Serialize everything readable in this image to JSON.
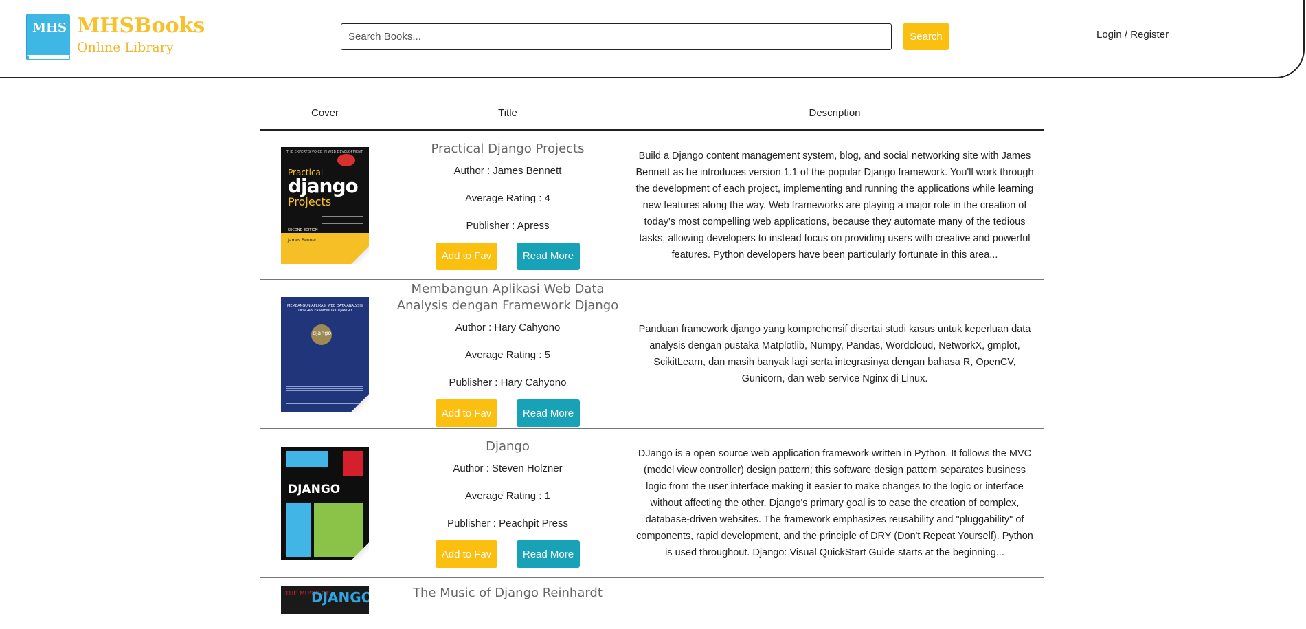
{
  "header": {
    "logo_badge": "MHS",
    "logo_name": "MHSBooks",
    "logo_subtitle": "Online Library",
    "search_placeholder": "Search Books...",
    "search_label": "Search",
    "login_label": "Login / Register"
  },
  "table": {
    "columns": [
      "Cover",
      "Title",
      "Description"
    ],
    "rows": [
      {
        "title": "Practical Django Projects",
        "author": "Author : James Bennett",
        "rating": "Average Rating : 4",
        "publisher": "Publisher : Apress",
        "fav_label": "Add to Fav",
        "more_label": "Read More",
        "description": "Build a Django content management system, blog, and social networking site with James Bennett as he introduces version 1.1 of the popular Django framework. You'll work through the development of each project, implementing and running the applications while learning new features along the way. Web frameworks are playing a major role in the creation of today's most compelling web applications, because they automate many of the tedious tasks, allowing developers to instead focus on providing users with creative and powerful features. Python developers have been particularly fortunate in this area...",
        "cover": {
          "top_text": "THE EXPERT'S VOICE IN WEB DEVELOPMENT",
          "line1": "Practical",
          "line2": "django",
          "line3": "Projects",
          "edition": "SECOND EDITION",
          "author": "James Bennett"
        }
      },
      {
        "title": "Membangun Aplikasi Web Data Analysis dengan Framework Django",
        "author": "Author : Hary Cahyono",
        "rating": "Average Rating : 5",
        "publisher": "Publisher : Hary Cahyono",
        "fav_label": "Add to Fav",
        "more_label": "Read More",
        "description": "Panduan framework django yang komprehensif disertai studi kasus untuk keperluan data analysis dengan pustaka Matplotlib, Numpy, Pandas, Wordcloud, NetworkX, gmplot, ScikitLearn, dan masih banyak lagi serta integrasinya dengan bahasa R, OpenCV, Gunicorn, dan web service Nginx di Linux.",
        "cover": {
          "top_text": "MEMBANGUN APLIKASI WEB DATA ANALYSIS DENGAN FRAMEWORK DJANGO",
          "line1": "django"
        }
      },
      {
        "title": "Django",
        "author": "Author : Steven Holzner",
        "rating": "Average Rating : 1",
        "publisher": "Publisher : Peachpit Press",
        "fav_label": "Add to Fav",
        "more_label": "Read More",
        "description": "DJango is a open source web application framework written in Python. It follows the MVC (model view controller) design pattern; this software design pattern separates business logic from the user interface making it easier to make changes to the logic or interface without affecting the other. Django's primary goal is to ease the creation of complex, database-driven websites. The framework emphasizes reusability and \"pluggability\" of components, rapid development, and the principle of DRY (Don't Repeat Yourself). Python is used throughout. Django: Visual QuickStart Guide starts at the beginning...",
        "cover": {
          "line1": "DJANGO"
        }
      },
      {
        "title": "The Music of Django Reinhardt",
        "cover": {
          "line1": "THE MUSIC OF",
          "line2": "DJANGO"
        }
      }
    ]
  },
  "colors": {
    "accent": "#fbbf0f",
    "info": "#17a2b8",
    "logo_blue": "#3fb7e4"
  }
}
